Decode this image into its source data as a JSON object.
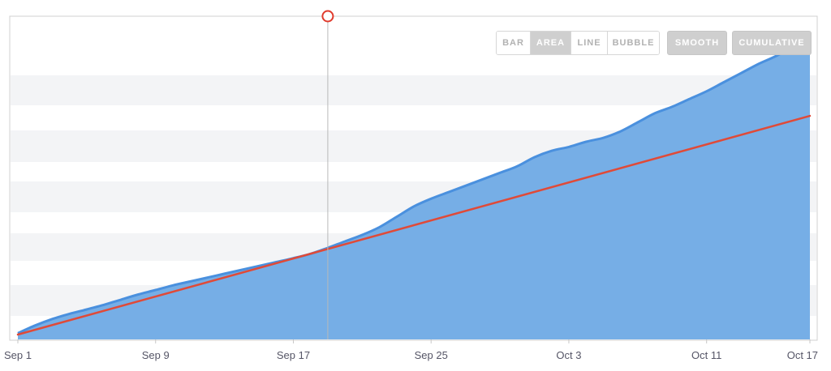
{
  "toolbar": {
    "chart_type_buttons": [
      {
        "label": "BAR",
        "active": false
      },
      {
        "label": "AREA",
        "active": true
      },
      {
        "label": "LINE",
        "active": false
      },
      {
        "label": "BUBBLE",
        "active": false
      }
    ],
    "smooth_label": "SMOOTH",
    "smooth_active": true,
    "cumulative_label": "CUMULATIVE",
    "cumulative_active": true
  },
  "colors": {
    "area_fill": "#76aee6",
    "area_line": "#4a90de",
    "trend_line": "#e04a38",
    "marker": "#e03a2c",
    "marker_line": "#b8b8b8",
    "grid_band": "#f3f4f6",
    "frame": "#d0d0d0"
  },
  "chart_data": {
    "type": "area",
    "smooth": true,
    "cumulative": true,
    "x_ticks": [
      "Sep 1",
      "Sep 9",
      "Sep 17",
      "Sep 25",
      "Oct 3",
      "Oct 11",
      "Oct 17"
    ],
    "x_tick_days": [
      0,
      8,
      16,
      24,
      32,
      40,
      46
    ],
    "xlim_days": [
      0,
      46
    ],
    "ylim": [
      0,
      100
    ],
    "grid": "horizontal bands",
    "series": [
      {
        "kind": "area",
        "x_days": [
          0,
          1,
          2,
          3,
          4,
          5,
          6,
          7,
          8,
          9,
          10,
          11,
          12,
          13,
          14,
          15,
          16,
          17,
          18,
          19,
          20,
          21,
          22,
          23,
          24,
          25,
          26,
          27,
          28,
          29,
          30,
          31,
          32,
          33,
          34,
          35,
          36,
          37,
          38,
          39,
          40,
          41,
          42,
          43,
          44,
          45,
          46
        ],
        "values": [
          0.5,
          3.5,
          6,
          8,
          9.7,
          11.5,
          13.5,
          15.5,
          17.2,
          19,
          20.5,
          22,
          23.5,
          25,
          26.5,
          28,
          29.5,
          31.2,
          33.5,
          36,
          38.5,
          41.5,
          45.5,
          49.5,
          52.5,
          55,
          57.5,
          60,
          62.5,
          65,
          68.5,
          71,
          72.5,
          74.5,
          76,
          78.5,
          82,
          85.5,
          88,
          91,
          94,
          97.5,
          101,
          104.5,
          107.5,
          111,
          113.5
        ]
      },
      {
        "kind": "trend_line",
        "x_days": [
          0,
          46
        ],
        "values": [
          0,
          84.5
        ]
      }
    ],
    "marker": {
      "x_day": 18,
      "label": ""
    }
  }
}
